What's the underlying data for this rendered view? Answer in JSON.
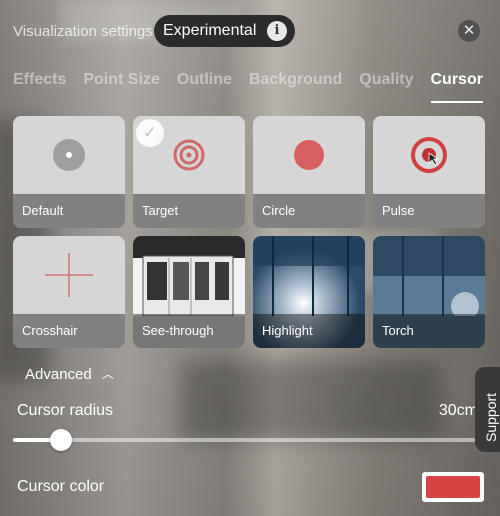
{
  "header": {
    "title": "Visualization settings",
    "badge_label": "Experimental",
    "info_icon": "i",
    "close_icon": "✕"
  },
  "tabs": [
    {
      "label": "Effects",
      "active": false
    },
    {
      "label": "Point Size",
      "active": false
    },
    {
      "label": "Outline",
      "active": false
    },
    {
      "label": "Background",
      "active": false
    },
    {
      "label": "Quality",
      "active": false
    },
    {
      "label": "Cursor",
      "active": true
    }
  ],
  "cursor_options": [
    {
      "label": "Default",
      "icon": "default-dot-icon",
      "selected": false
    },
    {
      "label": "Target",
      "icon": "target-icon",
      "selected": true
    },
    {
      "label": "Circle",
      "icon": "circle-icon",
      "selected": false
    },
    {
      "label": "Pulse",
      "icon": "pulse-icon",
      "selected": false
    },
    {
      "label": "Crosshair",
      "icon": "crosshair-icon",
      "selected": false
    },
    {
      "label": "See-through",
      "icon": "see-through-thumbnail",
      "selected": false
    },
    {
      "label": "Highlight",
      "icon": "highlight-thumbnail",
      "selected": false
    },
    {
      "label": "Torch",
      "icon": "torch-thumbnail",
      "selected": false
    }
  ],
  "check_icon": "✓",
  "advanced": {
    "label": "Advanced",
    "chevron_icon": "︿"
  },
  "cursor_radius": {
    "label": "Cursor radius",
    "value_text": "30cm",
    "slider_fraction": 0.1
  },
  "cursor_color": {
    "label": "Cursor color",
    "value": "#d64545"
  },
  "support": {
    "label": "Support"
  },
  "colors": {
    "accent_red": "#d64545",
    "tab_active": "#ffffff"
  }
}
